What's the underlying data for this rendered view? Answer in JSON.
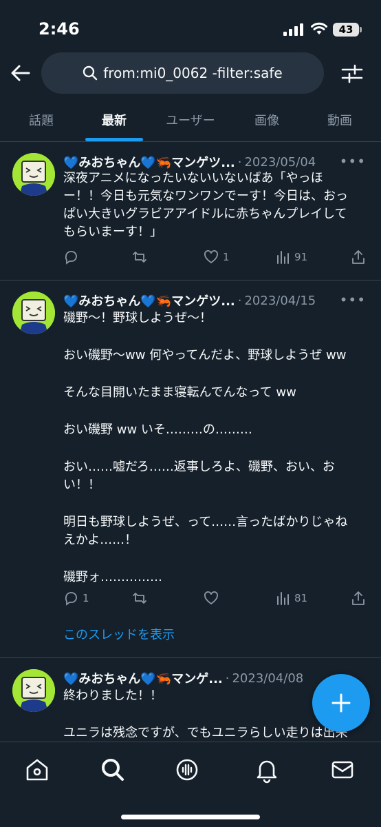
{
  "status_bar": {
    "time": "2:46",
    "battery": "43"
  },
  "search": {
    "query": "from:mi0_0062 -filter:safe"
  },
  "tabs": [
    {
      "label": "話題",
      "active": false
    },
    {
      "label": "最新",
      "active": true
    },
    {
      "label": "ユーザー",
      "active": false
    },
    {
      "label": "画像",
      "active": false
    },
    {
      "label": "動画",
      "active": false
    }
  ],
  "tweets": [
    {
      "name": "💙みおちゃん💙🦐マンゲツ...",
      "date": "2023/05/04",
      "lines": [
        "深夜アニメになったいないいないばあ「やっほ",
        "ー！！今日も元気なワンワンでーす！今日は、おっ",
        "ぱい大きいグラビアアイドルに赤ちゃんプレイして",
        "もらいまーす！」"
      ],
      "replies": "",
      "retweets": "",
      "likes": "1",
      "views": "91"
    },
    {
      "name": "💙みおちゃん💙🦐マンゲツ...",
      "date": "2023/04/15",
      "lines": [
        "磯野〜！野球しようぜ〜！",
        "",
        "おい磯野〜ww 何やってんだよ、野球しようぜ ww",
        "",
        "そんな目開いたまま寝転んでんなって ww",
        "",
        "おい磯野 ww いそ………の………",
        "",
        "おい……嘘だろ……返事しろよ、磯野、おい、お",
        "い！！",
        "",
        "明日も野球しようぜ、って……言ったばかりじゃね",
        "えかよ……！",
        "",
        "磯野ォ……………"
      ],
      "replies": "1",
      "retweets": "",
      "likes": "",
      "views": "81",
      "thread_link": "このスレッドを表示"
    },
    {
      "name": "💙みおちゃん💙🦐マンゲ...",
      "date": "2023/04/08",
      "lines": [
        "終わりました！！",
        "",
        "ユニラは残念ですが、でもユニラらしい走りは出来"
      ]
    }
  ],
  "icons": {
    "back": "arrow-left-icon",
    "search": "search-icon",
    "filter": "sliders-icon",
    "compose": "plus-icon",
    "nav": [
      "home-icon",
      "search-icon",
      "spaces-icon",
      "bell-icon",
      "mail-icon"
    ]
  },
  "colors": {
    "background": "#15202b",
    "accent": "#1d9bf0",
    "muted": "#8b98a5",
    "divider": "#38444d"
  }
}
